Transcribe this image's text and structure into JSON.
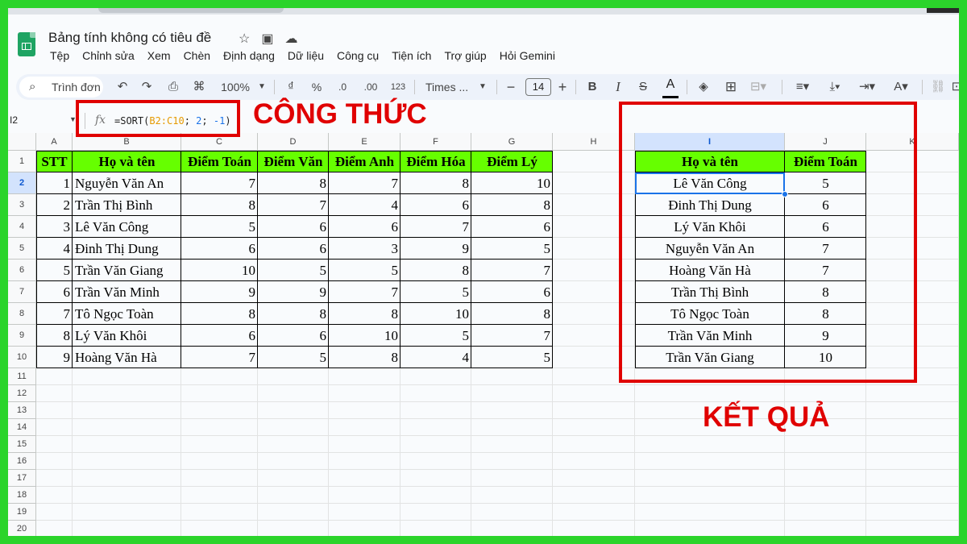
{
  "app": {
    "doc_title": "Bảng tính không có tiêu đề",
    "menu": [
      "Tệp",
      "Chỉnh sửa",
      "Xem",
      "Chèn",
      "Định dạng",
      "Dữ liệu",
      "Công cụ",
      "Tiện ích",
      "Trợ giúp",
      "Hỏi Gemini"
    ]
  },
  "toolbar": {
    "search_label": "Trình đơn",
    "zoom": "100%",
    "currency": "₫",
    "percent": "%",
    "dec_less": ".0",
    "dec_more": ".00",
    "number_format": "123",
    "font": "Times ...",
    "font_size": "14"
  },
  "formula_bar": {
    "name_box": "I2",
    "formula_prefix": "=SORT(",
    "formula_range": "B2:C10",
    "formula_sep1": "; ",
    "formula_arg2": "2",
    "formula_sep2": "; ",
    "formula_arg3": "-1",
    "formula_suffix": ")"
  },
  "annotations": {
    "formula_label": "CÔNG THỨC",
    "result_label": "KẾT QUẢ",
    "color": "#e00000"
  },
  "sheet": {
    "columns": [
      "A",
      "B",
      "C",
      "D",
      "E",
      "F",
      "G",
      "H",
      "I",
      "J",
      "K"
    ],
    "row_numbers": [
      "1",
      "2",
      "3",
      "4",
      "5",
      "6",
      "7",
      "8",
      "9",
      "10",
      "11",
      "12",
      "13",
      "14",
      "15",
      "16",
      "17",
      "18",
      "19",
      "20"
    ],
    "header_fill": "#66ff00",
    "headers": [
      "STT",
      "Họ và tên",
      "Điểm Toán",
      "Điểm Văn",
      "Điểm Anh",
      "Điểm Hóa",
      "Điểm Lý"
    ],
    "rows": [
      [
        "1",
        "Nguyễn Văn An",
        "7",
        "8",
        "7",
        "8",
        "10"
      ],
      [
        "2",
        "Trần Thị Bình",
        "8",
        "7",
        "4",
        "6",
        "8"
      ],
      [
        "3",
        "Lê Văn Công",
        "5",
        "6",
        "6",
        "7",
        "6"
      ],
      [
        "4",
        "Đinh Thị Dung",
        "6",
        "6",
        "3",
        "9",
        "5"
      ],
      [
        "5",
        "Trần Văn Giang",
        "10",
        "5",
        "5",
        "8",
        "7"
      ],
      [
        "6",
        "Trần Văn Minh",
        "9",
        "9",
        "7",
        "5",
        "6"
      ],
      [
        "7",
        "Tô Ngọc Toàn",
        "8",
        "8",
        "8",
        "10",
        "8"
      ],
      [
        "8",
        "Lý Văn Khôi",
        "6",
        "6",
        "10",
        "5",
        "7"
      ],
      [
        "9",
        "Hoàng Văn Hà",
        "7",
        "5",
        "8",
        "4",
        "5"
      ]
    ],
    "result_headers": [
      "Họ và tên",
      "Điểm Toán"
    ],
    "result_rows": [
      [
        "Lê Văn Công",
        "5"
      ],
      [
        "Đinh Thị Dung",
        "6"
      ],
      [
        "Lý Văn Khôi",
        "6"
      ],
      [
        "Nguyễn Văn An",
        "7"
      ],
      [
        "Hoàng Văn Hà",
        "7"
      ],
      [
        "Trần Thị Bình",
        "8"
      ],
      [
        "Tô Ngọc Toàn",
        "8"
      ],
      [
        "Trần Văn Minh",
        "9"
      ],
      [
        "Trần Văn Giang",
        "10"
      ]
    ]
  }
}
